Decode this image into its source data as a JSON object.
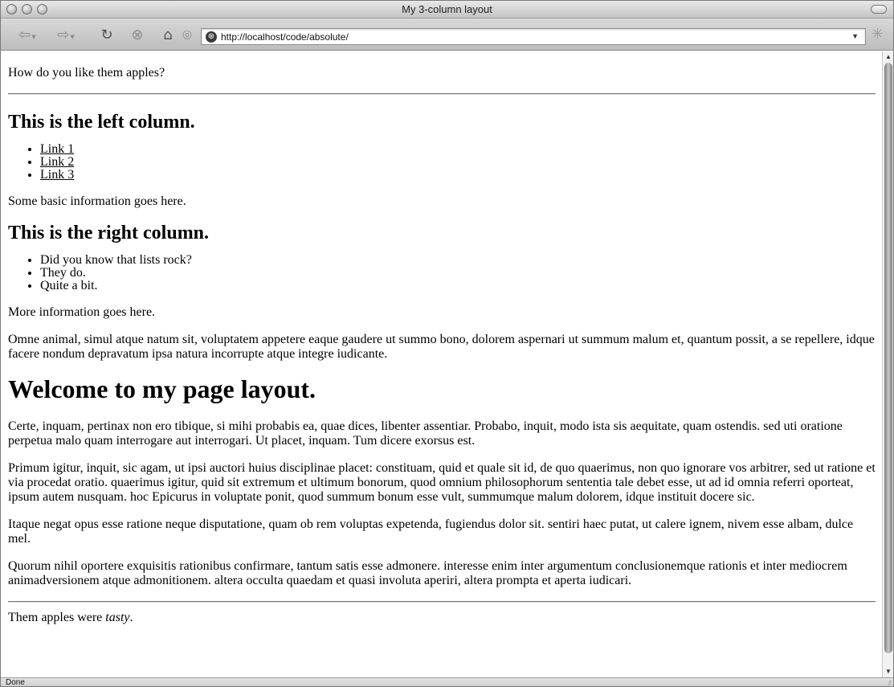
{
  "window": {
    "title": "My 3-column layout"
  },
  "toolbar": {
    "back_icon": "back-arrow-icon",
    "forward_icon": "forward-arrow-icon",
    "reload_icon": "reload-icon",
    "stop_icon": "stop-icon",
    "home_icon": "home-icon",
    "url": "http://localhost/code/absolute/"
  },
  "page": {
    "intro": "How do you like them apples?",
    "left_heading": "This is the left column.",
    "left_links": [
      "Link 1",
      "Link 2",
      "Link 3"
    ],
    "left_info": "Some basic information goes here.",
    "right_heading": "This is the right column.",
    "right_items": [
      "Did you know that lists rock?",
      "They do.",
      "Quite a bit."
    ],
    "right_info": "More information goes here.",
    "omne_paragraph": "Omne animal, simul atque natum sit, voluptatem appetere eaque gaudere ut summo bono, dolorem aspernari ut summum malum et, quantum possit, a se repellere, idque facere nondum depravatum ipsa natura incorrupte atque integre iudicante.",
    "main_heading": "Welcome to my page layout.",
    "paragraphs": [
      "Certe, inquam, pertinax non ero tibique, si mihi probabis ea, quae dices, libenter assentiar. Probabo, inquit, modo ista sis aequitate, quam ostendis. sed uti oratione perpetua malo quam interrogare aut interrogari. Ut placet, inquam. Tum dicere exorsus est.",
      "Primum igitur, inquit, sic agam, ut ipsi auctori huius disciplinae placet: constituam, quid et quale sit id, de quo quaerimus, non quo ignorare vos arbitrer, sed ut ratione et via procedat oratio. quaerimus igitur, quid sit extremum et ultimum bonorum, quod omnium philosophorum sententia tale debet esse, ut ad id omnia referri oporteat, ipsum autem nusquam. hoc Epicurus in voluptate ponit, quod summum bonum esse vult, summumque malum dolorem, idque instituit docere sic.",
      "Itaque negat opus esse ratione neque disputatione, quam ob rem voluptas expetenda, fugiendus dolor sit. sentiri haec putat, ut calere ignem, nivem esse albam, dulce mel.",
      "Quorum nihil oportere exquisitis rationibus confirmare, tantum satis esse admonere. interesse enim inter argumentum conclusionemque rationis et inter mediocrem animadversionem atque admonitionem. altera occulta quaedam et quasi involuta aperiri, altera prompta et aperta iudicari."
    ],
    "footer_prefix": "Them apples were ",
    "footer_emphasis": "tasty",
    "footer_suffix": "."
  },
  "statusbar": {
    "text": "Done"
  }
}
